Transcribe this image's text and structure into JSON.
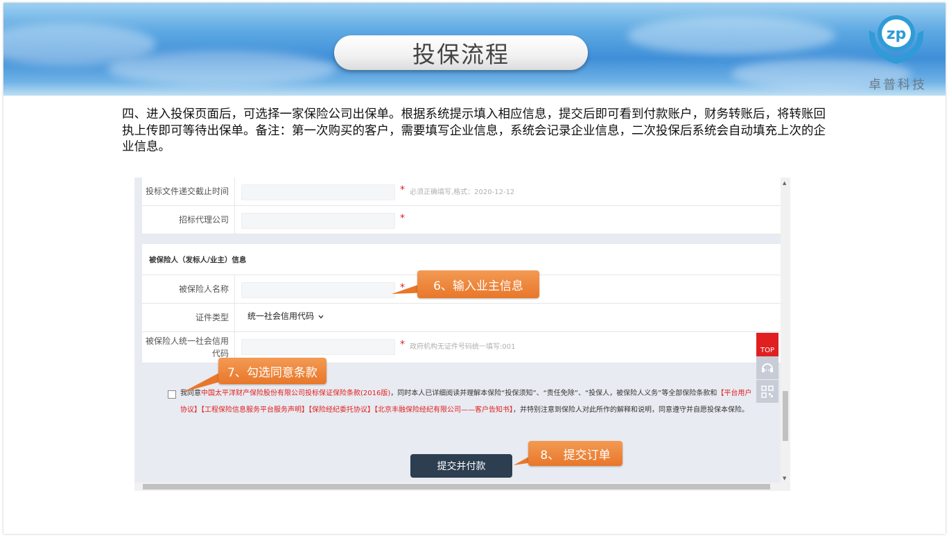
{
  "slide": {
    "title": "投保流程",
    "logo_text": "卓普科技",
    "description": "四、进入投保页面后，可选择一家保险公司出保单。根据系统提示填入相应信息，提交后即可看到付款账户，财务转账后，将转账回执上传即可等待出保单。备注：第一次购买的客户，需要填写企业信息，系统会记录企业信息，二次投保后系统会自动填充上次的企业信息。"
  },
  "form": {
    "rows_top": [
      {
        "label": "投标文件递交截止时间",
        "required": "*",
        "hint": "必须正确填写,格式：2020-12-12"
      },
      {
        "label": "招标代理公司",
        "required": "*",
        "hint": ""
      }
    ],
    "section_title": "被保险人（发标人/业主）信息",
    "insured_name_label": "被保险人名称",
    "insured_name_required": "*",
    "cert_type_label": "证件类型",
    "cert_type_value": "统一社会信用代码",
    "credit_code_label": "被保险人统一社会信用代码",
    "credit_code_required": "*",
    "credit_code_hint": "政府机构无证件号码统一填写:001"
  },
  "agreement": {
    "prefix": "我同意",
    "clause": "中国太平洋财产保险股份有限公司投标保证保险条款(2016版)",
    "mid1": "，同时本人已详细阅读并理解本保险“投保须知”、“责任免除”、“投保人，被保险人义务”等全部保险条款和",
    "link1": "【平台用户协议】",
    "link2": "【工程保险信息服务平台服务声明】",
    "link3": "【保险经纪委托协议】",
    "link4": "【北京丰融保险经纪有限公司——客户告知书】",
    "suffix": "，并特别注意到保险人对此所作的解释和说明，同意遵守并自愿投保本保险。"
  },
  "submit_label": "提交并付款",
  "side_top_label": "TOP",
  "callouts": {
    "c6": "6、输入业主信息",
    "c7": "7、勾选同意条款",
    "c8": "8、 提交订单"
  },
  "colors": {
    "callout": "#e8772a",
    "required": "#e02020",
    "submit": "#2c3e50",
    "banner": "#3f8fd8"
  },
  "icons": [
    "logo-icon",
    "chevron-down-icon",
    "headset-icon",
    "qrcode-icon",
    "scroll-up-icon",
    "scroll-down-icon"
  ]
}
